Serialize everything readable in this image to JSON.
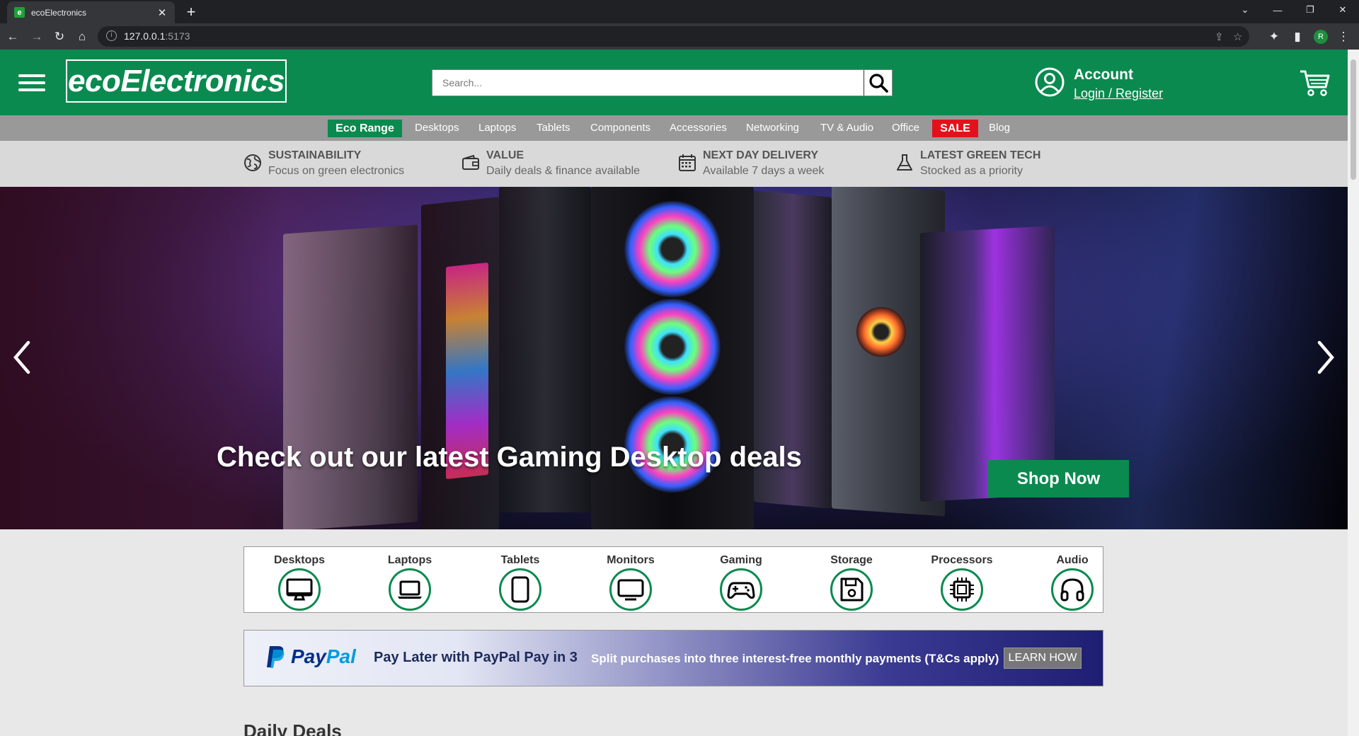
{
  "browser": {
    "tab_title": "ecoElectronics",
    "favicon_letter": "e",
    "url_host": "127.0.0.1",
    "url_port": ":5173",
    "profile_initial": "R"
  },
  "header": {
    "logo_text": "ecoElectronics",
    "search_placeholder": "Search...",
    "account_title": "Account",
    "account_link": "Login / Register",
    "brand_color": "#0a8a4f"
  },
  "nav": {
    "eco_label": "Eco Range",
    "items": [
      "Desktops",
      "Laptops",
      "Tablets",
      "Components",
      "Accessories",
      "Networking",
      "TV & Audio",
      "Office"
    ],
    "sale_label": "SALE",
    "blog_label": "Blog"
  },
  "usps": [
    {
      "icon": "globe-icon",
      "title": "SUSTAINABILITY",
      "subtitle": "Focus on green electronics"
    },
    {
      "icon": "wallet-icon",
      "title": "VALUE",
      "subtitle": "Daily deals & finance available"
    },
    {
      "icon": "calendar-icon",
      "title": "NEXT DAY DELIVERY",
      "subtitle": "Available 7 days a week"
    },
    {
      "icon": "flask-icon",
      "title": "LATEST GREEN TECH",
      "subtitle": "Stocked as a priority"
    }
  ],
  "hero": {
    "caption": "Check out our latest Gaming Desktop deals",
    "button_label": "Shop Now"
  },
  "categories": [
    {
      "label": "Desktops",
      "icon": "desktop-icon"
    },
    {
      "label": "Laptops",
      "icon": "laptop-icon"
    },
    {
      "label": "Tablets",
      "icon": "tablet-icon"
    },
    {
      "label": "Monitors",
      "icon": "monitor-icon"
    },
    {
      "label": "Gaming",
      "icon": "gamepad-icon"
    },
    {
      "label": "Storage",
      "icon": "floppy-disk-icon"
    },
    {
      "label": "Processors",
      "icon": "cpu-icon"
    },
    {
      "label": "Audio",
      "icon": "headphones-icon"
    }
  ],
  "paypal": {
    "logo_pay": "Pay",
    "logo_pal": "Pal",
    "headline": "Pay Later with PayPal Pay in 3",
    "subtext": "Split purchases into three interest-free monthly payments (T&Cs apply)",
    "button_label": "LEARN HOW"
  },
  "daily_deals_heading": "Daily Deals"
}
